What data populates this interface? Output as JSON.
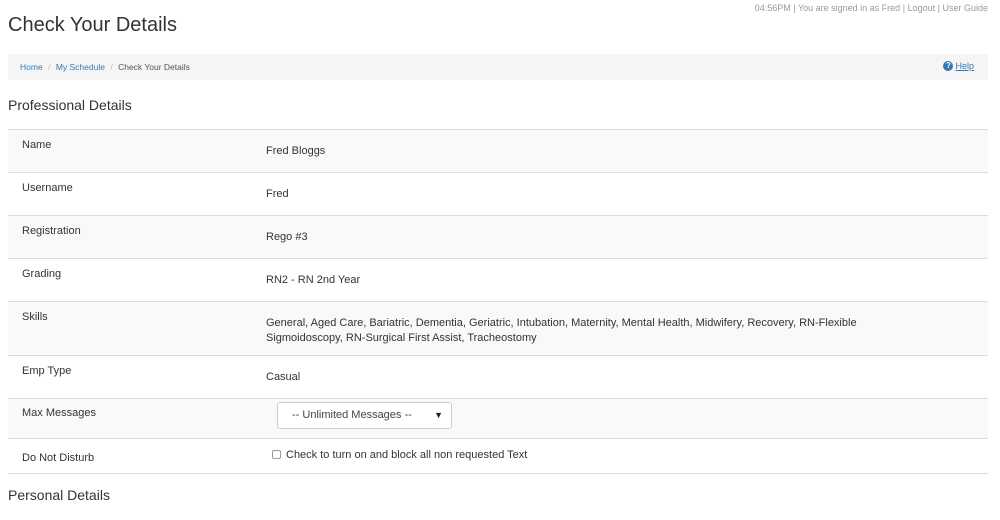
{
  "page": {
    "title": "Check Your Details"
  },
  "topbar": {
    "time": "04:56PM",
    "signed_in": "You are signed in as Fred",
    "logout": "Logout",
    "user_guide": "User Guide",
    "sep": "|"
  },
  "breadcrumb": {
    "home": "Home",
    "schedule": "My Schedule",
    "current": "Check Your Details",
    "sep": "/"
  },
  "help": {
    "label": "Help",
    "icon": "?"
  },
  "professional": {
    "heading": "Professional Details",
    "name": {
      "label": "Name",
      "value": "Fred Bloggs"
    },
    "username": {
      "label": "Username",
      "value": "Fred"
    },
    "registration": {
      "label": "Registration",
      "value": "Rego #3"
    },
    "grading": {
      "label": "Grading",
      "value": "RN2 - RN 2nd Year"
    },
    "skills": {
      "label": "Skills",
      "value": "General, Aged Care, Bariatric, Dementia, Geriatric, Intubation, Maternity, Mental Health, Midwifery, Recovery, RN-Flexible Sigmoidoscopy, RN-Surgical First Assist, Tracheostomy"
    },
    "emp_type": {
      "label": "Emp Type",
      "value": "Casual"
    },
    "max_messages": {
      "label": "Max Messages",
      "selected": "-- Unlimited Messages --"
    },
    "do_not_disturb": {
      "label": "Do Not Disturb",
      "checkbox_label": "Check to turn on and block all non requested Text",
      "checked": false
    }
  },
  "personal": {
    "heading": "Personal Details"
  }
}
